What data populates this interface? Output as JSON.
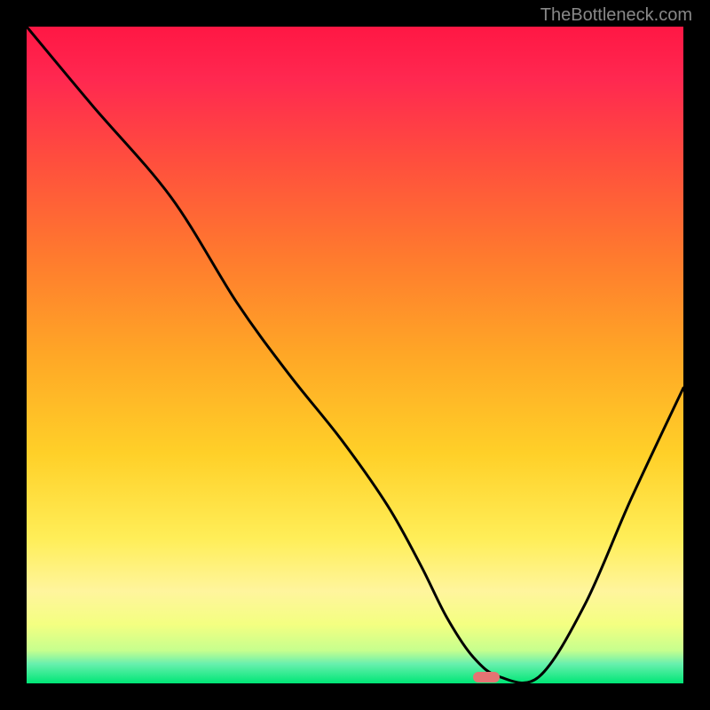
{
  "watermark": "TheBottleneck.com",
  "chart_data": {
    "type": "line",
    "title": "",
    "xlabel": "",
    "ylabel": "",
    "xlim": [
      0,
      100
    ],
    "ylim": [
      0,
      100
    ],
    "series": [
      {
        "name": "bottleneck-curve",
        "x": [
          0,
          10,
          22,
          32,
          40,
          48,
          55,
          60,
          64,
          68,
          72,
          78,
          85,
          92,
          100
        ],
        "y": [
          100,
          88,
          74,
          58,
          47,
          37,
          27,
          18,
          10,
          4,
          1,
          1,
          12,
          28,
          45
        ]
      }
    ],
    "marker": {
      "x": 70,
      "y": 1
    },
    "background_gradient_stops": [
      {
        "pos": 0,
        "color": "#ff1744"
      },
      {
        "pos": 50,
        "color": "#ffa726"
      },
      {
        "pos": 78,
        "color": "#ffee58"
      },
      {
        "pos": 100,
        "color": "#00e676"
      }
    ]
  }
}
